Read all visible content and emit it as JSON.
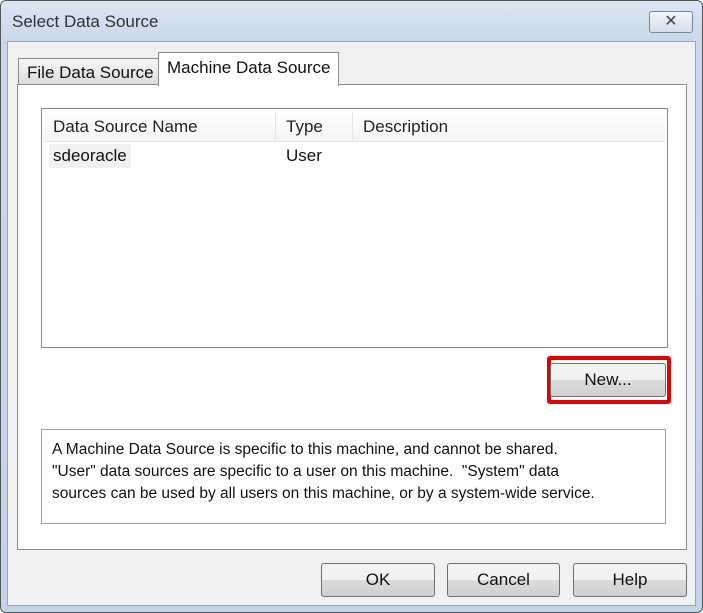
{
  "window": {
    "title": "Select Data Source",
    "close_label": "✕"
  },
  "tabs": [
    {
      "label": "File Data Source"
    },
    {
      "label": "Machine Data Source"
    }
  ],
  "list": {
    "columns": [
      "Data Source Name",
      "Type",
      "Description"
    ],
    "rows": [
      {
        "name": "sdeoracle",
        "type": "User",
        "description": ""
      }
    ]
  },
  "new_button": "New...",
  "description_lines": [
    "A Machine Data Source is specific to this machine, and cannot be shared.",
    "\"User\" data sources are specific to a user on this machine.  \"System\" data",
    "sources can be used by all users on this machine, or by a system-wide service."
  ],
  "buttons": {
    "ok": "OK",
    "cancel": "Cancel",
    "help": "Help"
  },
  "highlight_color": "#e00000"
}
